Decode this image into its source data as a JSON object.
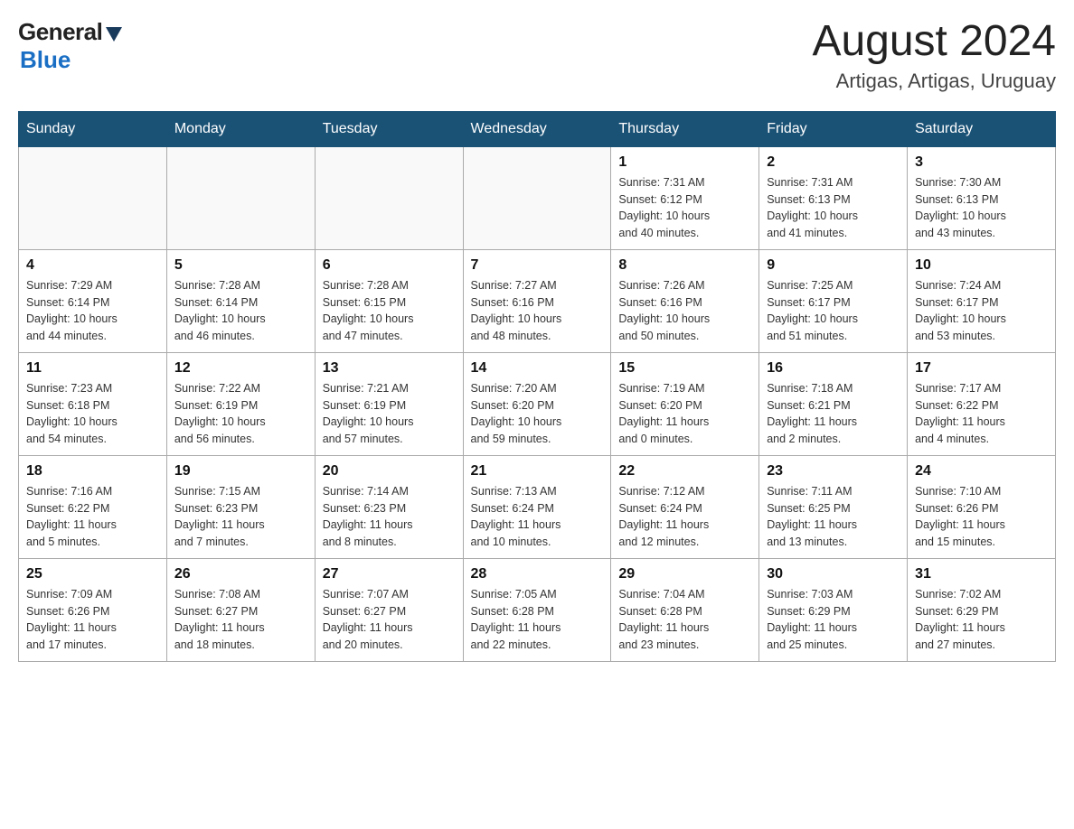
{
  "header": {
    "logo_general": "General",
    "logo_blue": "Blue",
    "month_title": "August 2024",
    "location": "Artigas, Artigas, Uruguay"
  },
  "calendar": {
    "days_of_week": [
      "Sunday",
      "Monday",
      "Tuesday",
      "Wednesday",
      "Thursday",
      "Friday",
      "Saturday"
    ],
    "weeks": [
      [
        {
          "day": "",
          "info": ""
        },
        {
          "day": "",
          "info": ""
        },
        {
          "day": "",
          "info": ""
        },
        {
          "day": "",
          "info": ""
        },
        {
          "day": "1",
          "info": "Sunrise: 7:31 AM\nSunset: 6:12 PM\nDaylight: 10 hours\nand 40 minutes."
        },
        {
          "day": "2",
          "info": "Sunrise: 7:31 AM\nSunset: 6:13 PM\nDaylight: 10 hours\nand 41 minutes."
        },
        {
          "day": "3",
          "info": "Sunrise: 7:30 AM\nSunset: 6:13 PM\nDaylight: 10 hours\nand 43 minutes."
        }
      ],
      [
        {
          "day": "4",
          "info": "Sunrise: 7:29 AM\nSunset: 6:14 PM\nDaylight: 10 hours\nand 44 minutes."
        },
        {
          "day": "5",
          "info": "Sunrise: 7:28 AM\nSunset: 6:14 PM\nDaylight: 10 hours\nand 46 minutes."
        },
        {
          "day": "6",
          "info": "Sunrise: 7:28 AM\nSunset: 6:15 PM\nDaylight: 10 hours\nand 47 minutes."
        },
        {
          "day": "7",
          "info": "Sunrise: 7:27 AM\nSunset: 6:16 PM\nDaylight: 10 hours\nand 48 minutes."
        },
        {
          "day": "8",
          "info": "Sunrise: 7:26 AM\nSunset: 6:16 PM\nDaylight: 10 hours\nand 50 minutes."
        },
        {
          "day": "9",
          "info": "Sunrise: 7:25 AM\nSunset: 6:17 PM\nDaylight: 10 hours\nand 51 minutes."
        },
        {
          "day": "10",
          "info": "Sunrise: 7:24 AM\nSunset: 6:17 PM\nDaylight: 10 hours\nand 53 minutes."
        }
      ],
      [
        {
          "day": "11",
          "info": "Sunrise: 7:23 AM\nSunset: 6:18 PM\nDaylight: 10 hours\nand 54 minutes."
        },
        {
          "day": "12",
          "info": "Sunrise: 7:22 AM\nSunset: 6:19 PM\nDaylight: 10 hours\nand 56 minutes."
        },
        {
          "day": "13",
          "info": "Sunrise: 7:21 AM\nSunset: 6:19 PM\nDaylight: 10 hours\nand 57 minutes."
        },
        {
          "day": "14",
          "info": "Sunrise: 7:20 AM\nSunset: 6:20 PM\nDaylight: 10 hours\nand 59 minutes."
        },
        {
          "day": "15",
          "info": "Sunrise: 7:19 AM\nSunset: 6:20 PM\nDaylight: 11 hours\nand 0 minutes."
        },
        {
          "day": "16",
          "info": "Sunrise: 7:18 AM\nSunset: 6:21 PM\nDaylight: 11 hours\nand 2 minutes."
        },
        {
          "day": "17",
          "info": "Sunrise: 7:17 AM\nSunset: 6:22 PM\nDaylight: 11 hours\nand 4 minutes."
        }
      ],
      [
        {
          "day": "18",
          "info": "Sunrise: 7:16 AM\nSunset: 6:22 PM\nDaylight: 11 hours\nand 5 minutes."
        },
        {
          "day": "19",
          "info": "Sunrise: 7:15 AM\nSunset: 6:23 PM\nDaylight: 11 hours\nand 7 minutes."
        },
        {
          "day": "20",
          "info": "Sunrise: 7:14 AM\nSunset: 6:23 PM\nDaylight: 11 hours\nand 8 minutes."
        },
        {
          "day": "21",
          "info": "Sunrise: 7:13 AM\nSunset: 6:24 PM\nDaylight: 11 hours\nand 10 minutes."
        },
        {
          "day": "22",
          "info": "Sunrise: 7:12 AM\nSunset: 6:24 PM\nDaylight: 11 hours\nand 12 minutes."
        },
        {
          "day": "23",
          "info": "Sunrise: 7:11 AM\nSunset: 6:25 PM\nDaylight: 11 hours\nand 13 minutes."
        },
        {
          "day": "24",
          "info": "Sunrise: 7:10 AM\nSunset: 6:26 PM\nDaylight: 11 hours\nand 15 minutes."
        }
      ],
      [
        {
          "day": "25",
          "info": "Sunrise: 7:09 AM\nSunset: 6:26 PM\nDaylight: 11 hours\nand 17 minutes."
        },
        {
          "day": "26",
          "info": "Sunrise: 7:08 AM\nSunset: 6:27 PM\nDaylight: 11 hours\nand 18 minutes."
        },
        {
          "day": "27",
          "info": "Sunrise: 7:07 AM\nSunset: 6:27 PM\nDaylight: 11 hours\nand 20 minutes."
        },
        {
          "day": "28",
          "info": "Sunrise: 7:05 AM\nSunset: 6:28 PM\nDaylight: 11 hours\nand 22 minutes."
        },
        {
          "day": "29",
          "info": "Sunrise: 7:04 AM\nSunset: 6:28 PM\nDaylight: 11 hours\nand 23 minutes."
        },
        {
          "day": "30",
          "info": "Sunrise: 7:03 AM\nSunset: 6:29 PM\nDaylight: 11 hours\nand 25 minutes."
        },
        {
          "day": "31",
          "info": "Sunrise: 7:02 AM\nSunset: 6:29 PM\nDaylight: 11 hours\nand 27 minutes."
        }
      ]
    ]
  }
}
